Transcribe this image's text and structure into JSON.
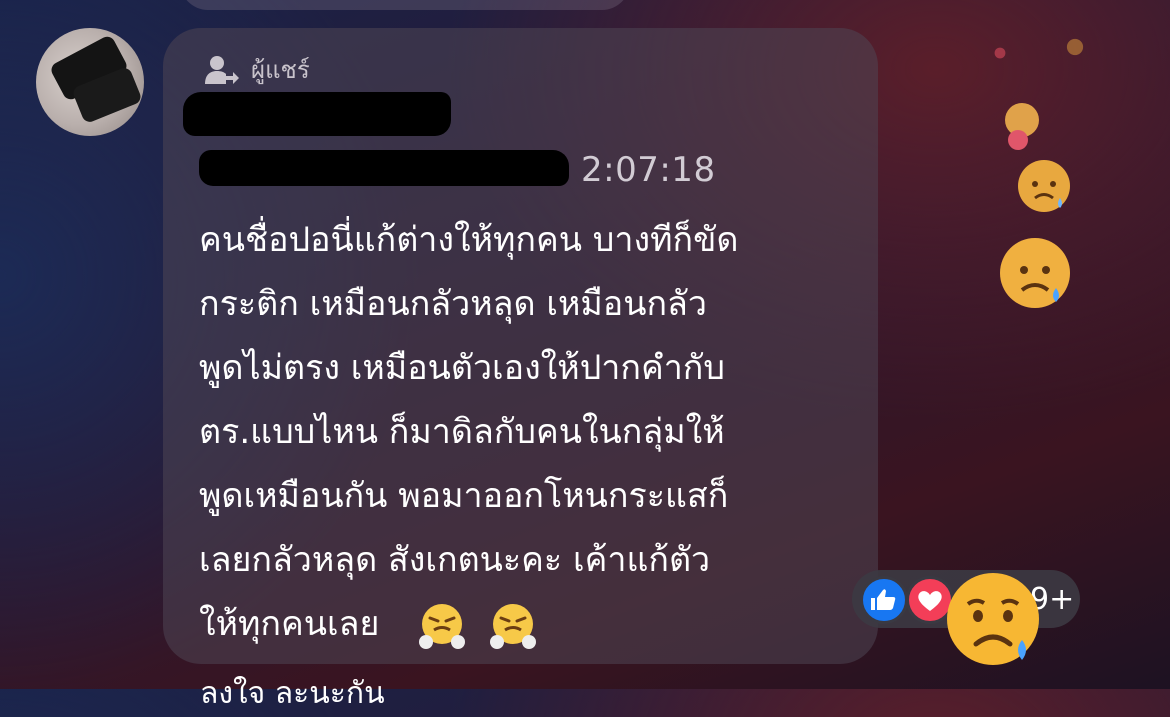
{
  "message": {
    "shared_label": "ผู้แชร์",
    "timestamp": "2:07:18",
    "lines": [
      "คนชื่อปอนี่แก้ต่างให้ทุกคน  บางทีก็ขัด",
      "กระติก  เหมือนกลัวหลุด เหมือนกลัว",
      "พูดไม่ตรง  เหมือนตัวเองให้ปากคำกับ",
      "ตร.แบบไหน ก็มาดิลกับคนในกลุ่มให้",
      "พูดเหมือนกัน  พอมาออกโหนกระแสก็",
      "เลยกลัวหลุด  สังเกตนะคะ  เค้าแก้ตัว",
      "ให้ทุกคนเลย"
    ],
    "inline_emojis": [
      "face-with-steam-icon",
      "face-with-steam-icon"
    ]
  },
  "reactions": {
    "types": [
      "like-icon",
      "love-icon",
      "sad-icon"
    ],
    "count": "9+"
  },
  "next_message_partial": "ลงใจ    ละนะกัน",
  "colors": {
    "like": "#1877f2",
    "love": "#f33e58",
    "sad": "#f7b733"
  }
}
